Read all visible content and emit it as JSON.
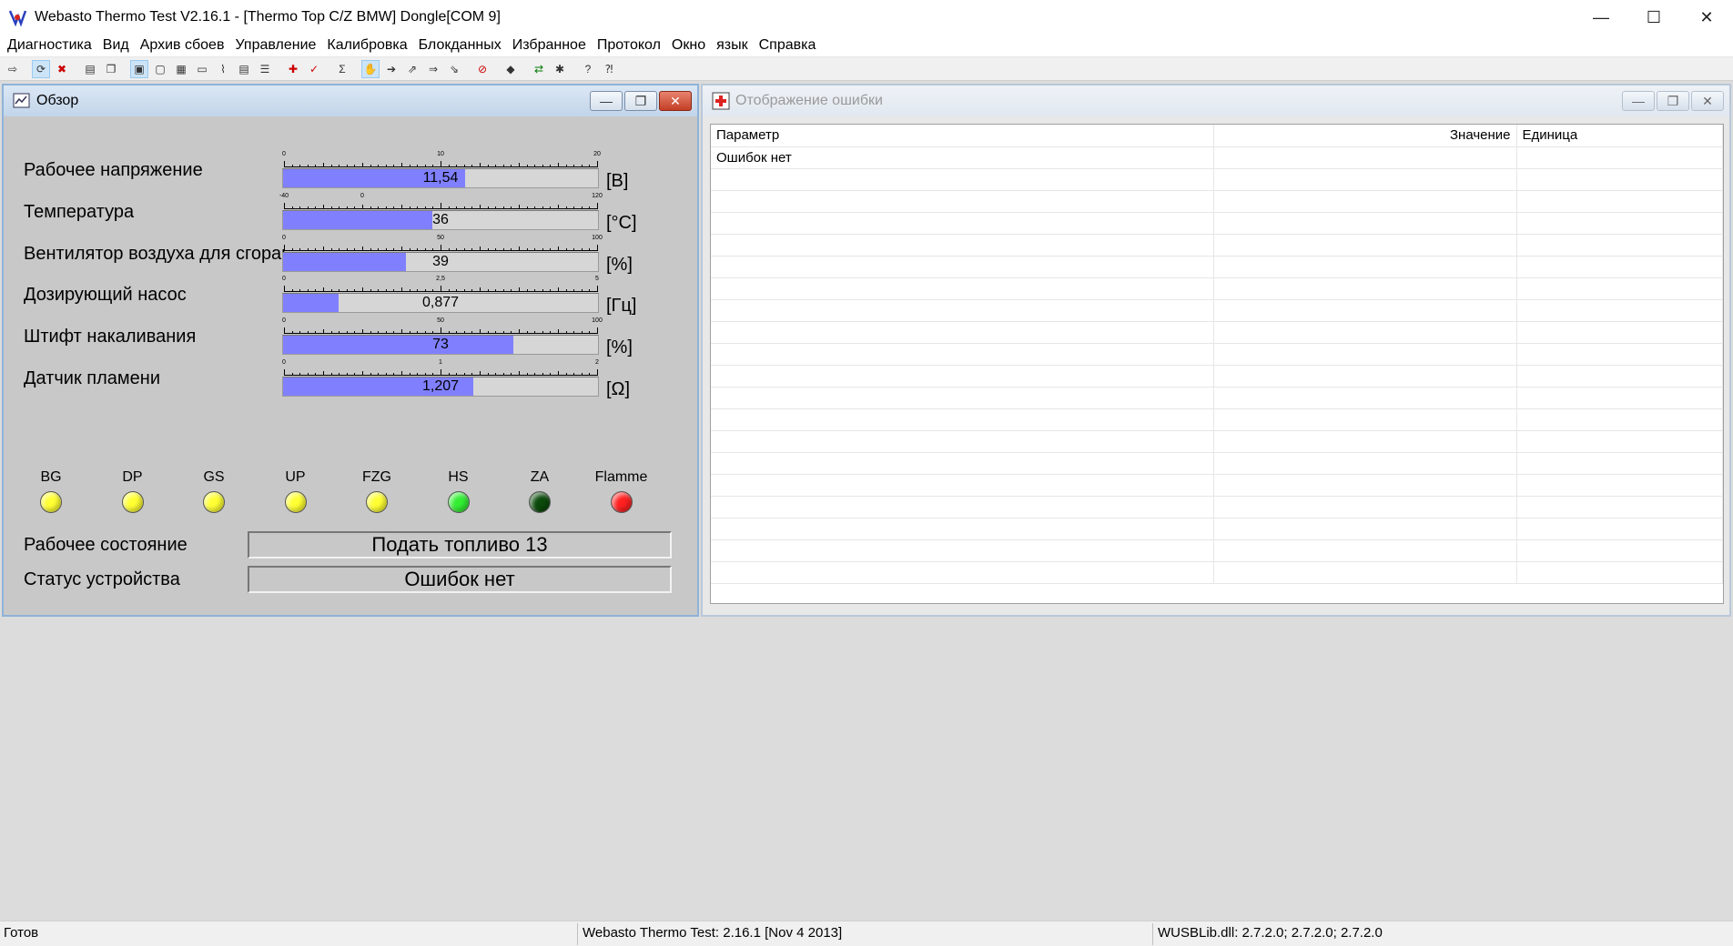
{
  "app": {
    "title": "Webasto Thermo Test V2.16.1 - [Thermo Top C/Z BMW] Dongle[COM 9]",
    "controls": {
      "minimize": "—",
      "maximize": "☐",
      "close": "✕"
    }
  },
  "menu": [
    {
      "label": "Диагностика"
    },
    {
      "label": "Вид"
    },
    {
      "label": "Архив сбоев"
    },
    {
      "label": "Управление"
    },
    {
      "label": "Калибровка"
    },
    {
      "label": "Блокданных"
    },
    {
      "label": "Избранное"
    },
    {
      "label": "Протокол"
    },
    {
      "label": "Окно"
    },
    {
      "label": "язык"
    },
    {
      "label": "Справка"
    }
  ],
  "overview": {
    "title": "Обзор",
    "params": [
      {
        "label": "Рабочее напряжение",
        "value": "11,54",
        "unit": "[В]",
        "fill": 0.577,
        "ticks": [
          "0",
          "10",
          "20"
        ]
      },
      {
        "label": "Температура",
        "value": "36",
        "unit": "[°C]",
        "fill": 0.475,
        "ticks": [
          "-40",
          "0",
          "120"
        ]
      },
      {
        "label": "Вентилятор воздуха для сгорания",
        "value": "39",
        "unit": "[%]",
        "fill": 0.39,
        "ticks": [
          "0",
          "50",
          "100"
        ]
      },
      {
        "label": "Дозирующий насос",
        "value": "0,877",
        "unit": "[Гц]",
        "fill": 0.175,
        "ticks": [
          "0",
          "2,5",
          "5"
        ]
      },
      {
        "label": "Штифт накаливания",
        "value": "73",
        "unit": "[%]",
        "fill": 0.73,
        "ticks": [
          "0",
          "50",
          "100"
        ]
      },
      {
        "label": "Датчик пламени",
        "value": "1,207",
        "unit": "[Ω]",
        "fill": 0.6035,
        "ticks": [
          "0",
          "1",
          "2"
        ]
      }
    ],
    "lamps": [
      {
        "label": "BG",
        "color": "#ffff33"
      },
      {
        "label": "DP",
        "color": "#ffff33"
      },
      {
        "label": "GS",
        "color": "#ffff33"
      },
      {
        "label": "UP",
        "color": "#ffff33"
      },
      {
        "label": "FZG",
        "color": "#ffff33"
      },
      {
        "label": "HS",
        "color": "#33ee33"
      },
      {
        "label": "ZA",
        "color": "#0b4a0b"
      },
      {
        "label": "Flamme",
        "color": "#ff2020"
      }
    ],
    "operating_state_label": "Рабочее состояние",
    "operating_state_value": "Подать топливо 13",
    "device_status_label": "Статус устройства",
    "device_status_value": "Ошибок нет"
  },
  "errors": {
    "title": "Отображение ошибки",
    "columns": [
      "Параметр",
      "Значение",
      "Единица"
    ],
    "rows": [
      [
        "Ошибок нет",
        "",
        ""
      ]
    ]
  },
  "statusbar": {
    "state": "Готов",
    "version": "Webasto Thermo Test: 2.16.1 [Nov  4 2013]",
    "dll": "WUSBLib.dll: 2.7.2.0; 2.7.2.0; 2.7.2.0"
  }
}
